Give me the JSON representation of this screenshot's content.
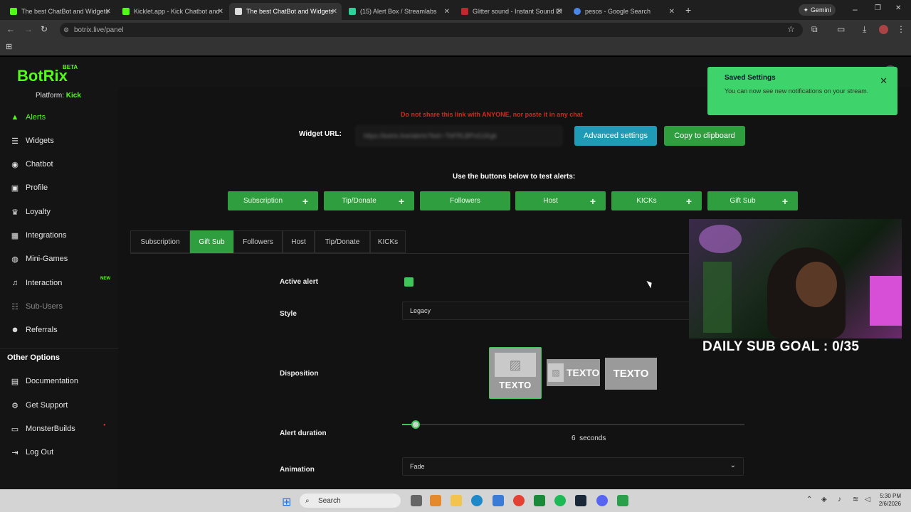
{
  "browser": {
    "tabs": [
      {
        "title": "The best ChatBot and Widgets",
        "active": false
      },
      {
        "title": "Kicklet.app - Kick Chatbot and",
        "active": false
      },
      {
        "title": "The best ChatBot and Widgets",
        "active": true
      },
      {
        "title": "(15) Alert Box / Streamlabs",
        "active": false
      },
      {
        "title": "Glitter sound - Instant Sound Ef",
        "active": false
      },
      {
        "title": "pesos - Google Search",
        "active": false
      }
    ],
    "gemini_label": "Gemini",
    "url": "botrix.live/panel"
  },
  "app": {
    "logo": "BotRix",
    "beta": "BETA",
    "platform_label": "Platform:",
    "platform_value": "Kick",
    "nav": [
      {
        "label": "Alerts",
        "icon": "bell-icon"
      },
      {
        "label": "Widgets",
        "icon": "list-icon"
      },
      {
        "label": "Chatbot",
        "icon": "robot-icon"
      },
      {
        "label": "Profile",
        "icon": "id-card-icon"
      },
      {
        "label": "Loyalty",
        "icon": "trophy-icon"
      },
      {
        "label": "Integrations",
        "icon": "grid-icon"
      },
      {
        "label": "Mini-Games",
        "icon": "gamepad-icon"
      },
      {
        "label": "Interaction",
        "icon": "music-icon"
      },
      {
        "label": "Sub-Users",
        "icon": "users-icon"
      },
      {
        "label": "Referrals",
        "icon": "user-plus-icon"
      }
    ],
    "new_badge": "NEW",
    "other_options": "Other Options",
    "other_nav": [
      {
        "label": "Documentation",
        "icon": "book-icon"
      },
      {
        "label": "Get Support",
        "icon": "support-icon"
      },
      {
        "label": "MonsterBuilds",
        "icon": "monitor-icon"
      },
      {
        "label": "Log Out",
        "icon": "logout-icon"
      }
    ]
  },
  "content": {
    "warning": "Do not share this link with ANYONE, nor paste it in any chat",
    "widget_url_label": "Widget URL:",
    "widget_url_value": "https://botrix.live/alerts?bid=-TbFRLBPnG1Kgk",
    "advanced_settings": "Advanced settings",
    "copy_clipboard": "Copy to clipboard",
    "test_label": "Use the buttons below to test alerts:",
    "test_buttons": [
      {
        "label": "Subscription",
        "plus": true
      },
      {
        "label": "Tip/Donate",
        "plus": true
      },
      {
        "label": "Followers",
        "plus": false
      },
      {
        "label": "Host",
        "plus": true
      },
      {
        "label": "KICKs",
        "plus": true
      },
      {
        "label": "Gift Sub",
        "plus": true
      }
    ],
    "plus": "+",
    "tabs": [
      "Subscription",
      "Gift Sub",
      "Followers",
      "Host",
      "Tip/Donate",
      "KICKs"
    ],
    "active_tab": "Gift Sub",
    "active_alert_label": "Active alert",
    "active_alert_on": true,
    "style_label": "Style",
    "style_value": "Legacy",
    "disposition_label": "Disposition",
    "disposition_text": "TEXTO",
    "alert_duration_label": "Alert duration",
    "alert_duration_value": "6",
    "alert_duration_unit": "seconds",
    "alert_duration_fraction": 0.04,
    "animation_label": "Animation",
    "animation_value": "Fade"
  },
  "toast": {
    "title": "Saved Settings",
    "message": "You can now see new notifications on your stream."
  },
  "overlay": {
    "goal_text": "DAILY SUB GOAL : 0/35"
  },
  "taskbar": {
    "search": "Search",
    "time": "5:30 PM",
    "date": "2/6/2026"
  },
  "colors": {
    "brand": "#53fc18",
    "button_green": "#2e9e3f",
    "advanced_blue": "#1f9bb6",
    "warning_red": "#d9261c"
  }
}
